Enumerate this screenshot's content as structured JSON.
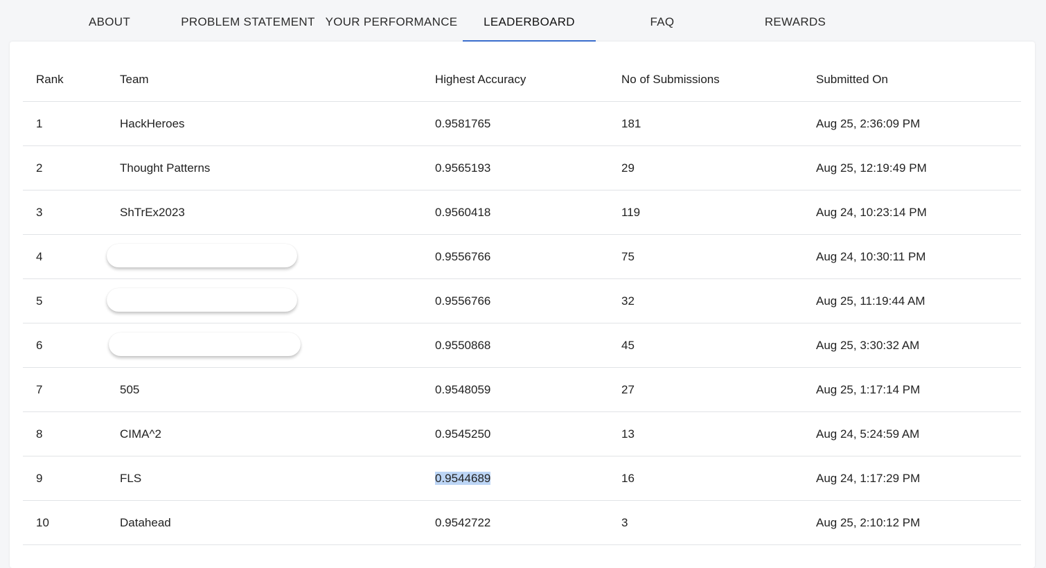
{
  "tabs": [
    {
      "label": "ABOUT",
      "active": false
    },
    {
      "label": "PROBLEM STATEMENT",
      "active": false
    },
    {
      "label": "YOUR PERFORMANCE",
      "active": false
    },
    {
      "label": "LEADERBOARD",
      "active": true
    },
    {
      "label": "FAQ",
      "active": false
    },
    {
      "label": "REWARDS",
      "active": false
    }
  ],
  "accent_color": "#3b6fd1",
  "leaderboard": {
    "columns": [
      "Rank",
      "Team",
      "Highest Accuracy",
      "No of Submissions",
      "Submitted On"
    ],
    "rows": [
      {
        "rank": "1",
        "team": "HackHeroes",
        "accuracy": "0.9581765",
        "submissions": "181",
        "submitted_on": "Aug 25, 2:36:09 PM"
      },
      {
        "rank": "2",
        "team": "Thought Patterns",
        "accuracy": "0.9565193",
        "submissions": "29",
        "submitted_on": "Aug 25, 12:19:49 PM"
      },
      {
        "rank": "3",
        "team": "ShTrEx2023",
        "accuracy": "0.9560418",
        "submissions": "119",
        "submitted_on": "Aug 24, 10:23:14 PM"
      },
      {
        "rank": "4",
        "team": "",
        "team_redacted": true,
        "accuracy": "0.9556766",
        "submissions": "75",
        "submitted_on": "Aug 24, 10:30:11 PM"
      },
      {
        "rank": "5",
        "team": "",
        "team_redacted": true,
        "accuracy": "0.9556766",
        "submissions": "32",
        "submitted_on": "Aug 25, 11:19:44 AM"
      },
      {
        "rank": "6",
        "team": "",
        "team_redacted": true,
        "accuracy": "0.9550868",
        "submissions": "45",
        "submitted_on": "Aug 25, 3:30:32 AM"
      },
      {
        "rank": "7",
        "team": "505",
        "accuracy": "0.9548059",
        "submissions": "27",
        "submitted_on": "Aug 25, 1:17:14 PM"
      },
      {
        "rank": "8",
        "team": "CIMA^2",
        "accuracy": "0.9545250",
        "submissions": "13",
        "submitted_on": "Aug 24, 5:24:59 AM"
      },
      {
        "rank": "9",
        "team": "FLS",
        "accuracy": "0.9544689",
        "accuracy_selected": true,
        "submissions": "16",
        "submitted_on": "Aug 24, 1:17:29 PM"
      },
      {
        "rank": "10",
        "team": "Datahead",
        "accuracy": "0.9542722",
        "submissions": "3",
        "submitted_on": "Aug 25, 2:10:12 PM"
      }
    ]
  }
}
